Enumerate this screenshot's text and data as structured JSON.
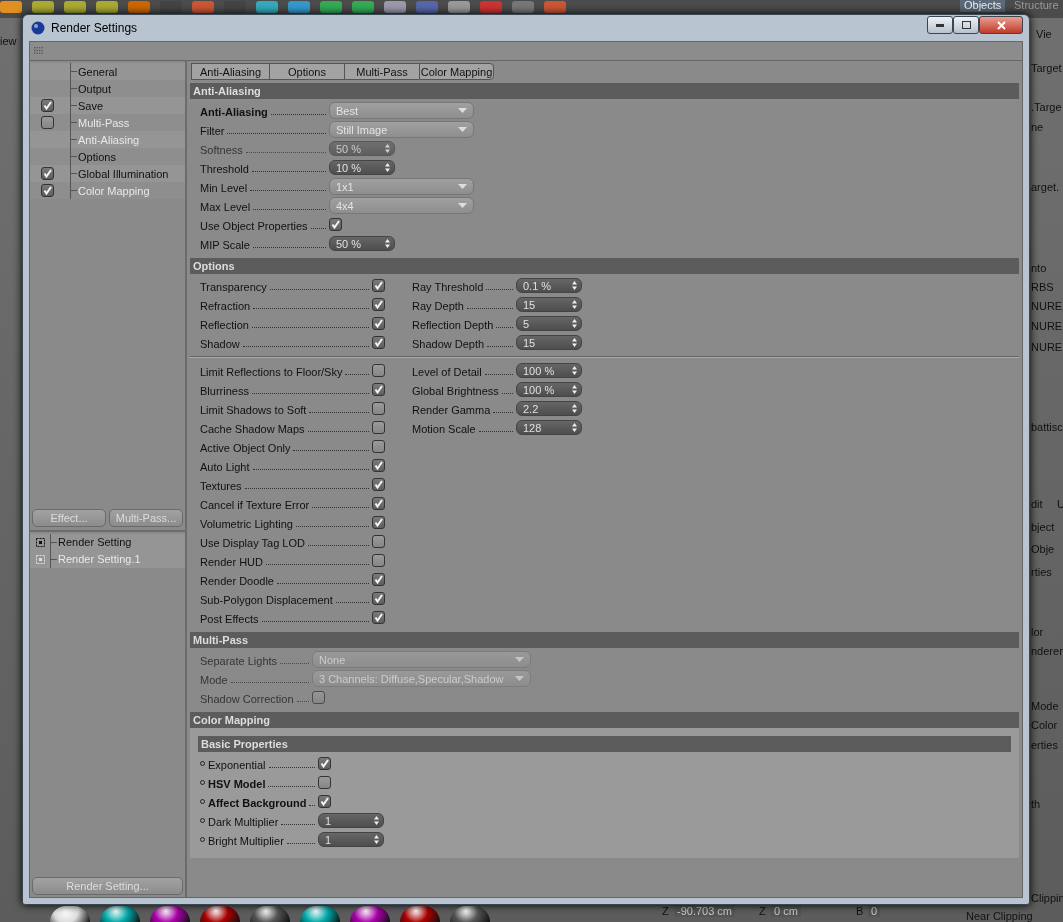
{
  "backdrop": {
    "panel_tabs": [
      "Objects",
      "Structure"
    ],
    "left_fragment": "iew",
    "top_right_fragment": "Vie",
    "right_fragments": [
      [
        "Target"
      ],
      [
        ".Targe"
      ],
      [
        "ne"
      ],
      [
        "arget."
      ],
      [
        "nto"
      ],
      [
        "RBS"
      ],
      [
        "NURE"
      ],
      [
        "NURE"
      ],
      [
        "NURE"
      ],
      [
        "battisc"
      ],
      [
        "dit",
        "U"
      ],
      [
        "bject"
      ],
      [
        "Obje"
      ],
      [
        "rties"
      ],
      [
        "lor"
      ],
      [
        "nderer"
      ],
      [
        "Mode"
      ],
      [
        "Color"
      ],
      [
        "erties"
      ],
      [
        "th"
      ],
      [
        "Clippin"
      ],
      [
        "Near Clipping"
      ]
    ],
    "coordinates": [
      {
        "axis": "Z",
        "value": "-90.703 cm"
      },
      {
        "axis": "Z",
        "value": "0 cm"
      },
      {
        "axis": "B",
        "value": "0"
      }
    ]
  },
  "window": {
    "title": "Render Settings"
  },
  "sidebar": {
    "items": [
      {
        "label": "General",
        "kind": "plain",
        "selected": false
      },
      {
        "label": "Output",
        "kind": "plain",
        "selected": false
      },
      {
        "label": "Save",
        "kind": "toggle",
        "checked": true,
        "selected": false
      },
      {
        "label": "Multi-Pass",
        "kind": "toggle",
        "checked": false,
        "selected": true
      },
      {
        "label": "Anti-Aliasing",
        "kind": "plain",
        "selected": true
      },
      {
        "label": "Options",
        "kind": "plain",
        "selected": false
      },
      {
        "label": "Global Illumination",
        "kind": "toggle",
        "checked": true,
        "selected": false
      },
      {
        "label": "Color Mapping",
        "kind": "toggle",
        "checked": true,
        "selected": true
      }
    ],
    "buttons": [
      "Effect...",
      "Multi-Pass..."
    ],
    "presets": [
      {
        "label": "Render Setting",
        "active": true
      },
      {
        "label": "Render Setting.1",
        "active": false
      }
    ],
    "footer_button": "Render Setting..."
  },
  "tabs": [
    "Anti-Aliasing",
    "Options",
    "Multi-Pass",
    "Color Mapping"
  ],
  "sections": [
    {
      "kind": "form",
      "title": "Anti-Aliasing",
      "rows": [
        {
          "label": "Anti-Aliasing",
          "kind": "dropdown",
          "value": "Best",
          "bold": true,
          "disabled": false
        },
        {
          "label": "Filter",
          "kind": "dropdown",
          "value": "Still Image",
          "bold": false,
          "disabled": false
        },
        {
          "label": "Softness",
          "kind": "spinner",
          "value": "50 %",
          "bold": false,
          "disabled": true
        },
        {
          "label": "Threshold",
          "kind": "spinner",
          "value": "10 %",
          "bold": false,
          "disabled": false
        },
        {
          "label": "Min Level",
          "kind": "dropdown",
          "value": "1x1",
          "bold": false,
          "disabled": false
        },
        {
          "label": "Max Level",
          "kind": "dropdown",
          "value": "4x4",
          "bold": false,
          "disabled": false
        },
        {
          "label": "Use Object Properties",
          "kind": "checkbox",
          "checked": true,
          "bold": false,
          "disabled": false
        },
        {
          "label": "MIP Scale",
          "kind": "spinner",
          "value": "50 %",
          "bold": false,
          "disabled": false
        }
      ]
    },
    {
      "kind": "columns",
      "title": "Options",
      "groups": [
        {
          "left": [
            {
              "label": "Transparency",
              "checked": true
            },
            {
              "label": "Refraction",
              "checked": true
            },
            {
              "label": "Reflection",
              "checked": true
            },
            {
              "label": "Shadow",
              "checked": true
            }
          ],
          "right": [
            {
              "label": "Ray Threshold",
              "value": "0.1 %"
            },
            {
              "label": "Ray Depth",
              "value": "15"
            },
            {
              "label": "Reflection Depth",
              "value": "5"
            },
            {
              "label": "Shadow Depth",
              "value": "15"
            }
          ]
        },
        {
          "left": [
            {
              "label": "Limit Reflections to Floor/Sky",
              "checked": false
            },
            {
              "label": "Blurriness",
              "checked": true
            },
            {
              "label": "Limit Shadows to Soft",
              "checked": false
            },
            {
              "label": "Cache Shadow Maps",
              "checked": false
            },
            {
              "label": "Active Object Only",
              "checked": false
            },
            {
              "label": "Auto Light",
              "checked": true
            },
            {
              "label": "Textures",
              "checked": true
            },
            {
              "label": "Cancel if Texture Error",
              "checked": true
            },
            {
              "label": "Volumetric Lighting",
              "checked": true
            },
            {
              "label": "Use Display Tag LOD",
              "checked": false
            },
            {
              "label": "Render HUD",
              "checked": false
            },
            {
              "label": "Render Doodle",
              "checked": true
            },
            {
              "label": "Sub-Polygon Displacement",
              "checked": true
            },
            {
              "label": "Post Effects",
              "checked": true
            }
          ],
          "right": [
            {
              "label": "Level of Detail",
              "value": "100 %"
            },
            {
              "label": "Global Brightness",
              "value": "100 %"
            },
            {
              "label": "Render Gamma",
              "value": "2.2"
            },
            {
              "label": "Motion Scale",
              "value": "128"
            }
          ]
        }
      ]
    },
    {
      "kind": "form",
      "title": "Multi-Pass",
      "rows": [
        {
          "label": "Separate Lights",
          "kind": "dropdown",
          "value": "None",
          "bold": false,
          "disabled": true
        },
        {
          "label": "Mode",
          "kind": "dropdown",
          "value": "3 Channels: Diffuse,Specular,Shadow",
          "bold": false,
          "disabled": true
        },
        {
          "label": "Shadow Correction",
          "kind": "checkbox",
          "checked": false,
          "bold": false,
          "disabled": true
        }
      ]
    },
    {
      "kind": "group",
      "title": "Color Mapping",
      "subsections": [
        {
          "title": "Basic Properties",
          "rows": [
            {
              "label": "Exponential",
              "kind": "checkbox",
              "checked": true,
              "bold": false,
              "disabled": false
            },
            {
              "label": "HSV Model",
              "kind": "checkbox",
              "checked": false,
              "bold": true,
              "disabled": false
            },
            {
              "label": "Affect Background",
              "kind": "checkbox",
              "checked": true,
              "bold": true,
              "disabled": false
            },
            {
              "label": "Dark Multiplier",
              "kind": "spinner",
              "value": "1",
              "bold": false,
              "disabled": false
            },
            {
              "label": "Bright Multiplier",
              "kind": "spinner",
              "value": "1",
              "bold": false,
              "disabled": false
            }
          ]
        }
      ]
    }
  ]
}
